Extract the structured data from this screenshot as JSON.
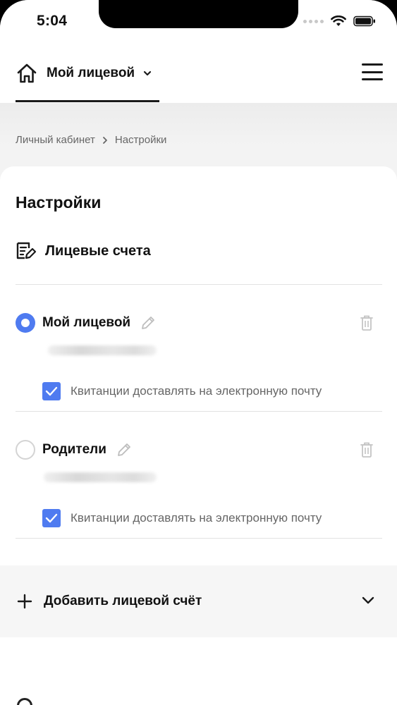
{
  "status_bar": {
    "time": "5:04"
  },
  "header": {
    "account_switch_label": "Мой лицевой"
  },
  "breadcrumb": [
    {
      "label": "Личный кабинет"
    },
    {
      "label": "Настройки"
    }
  ],
  "page": {
    "title": "Настройки",
    "section_title": "Лицевые счета"
  },
  "accounts": [
    {
      "name": "Мой лицевой",
      "selected": true,
      "number": "",
      "email_receipts_label": "Квитанции доставлять на электронную почту",
      "email_receipts_checked": true
    },
    {
      "name": "Родители",
      "selected": false,
      "number": "",
      "email_receipts_label": "Квитанции доставлять на электронную почту",
      "email_receipts_checked": true
    }
  ],
  "add_account": {
    "label": "Добавить лицевой счёт"
  },
  "colors": {
    "accent": "#4f7bf0",
    "text": "#111111",
    "muted": "#666666",
    "divider": "#e2e2e2"
  },
  "icons": [
    "home-icon",
    "chevron-down-icon",
    "menu-icon",
    "document-edit-icon",
    "pencil-icon",
    "trash-icon",
    "plus-icon",
    "checkmark-icon",
    "wifi-icon",
    "battery-icon"
  ]
}
